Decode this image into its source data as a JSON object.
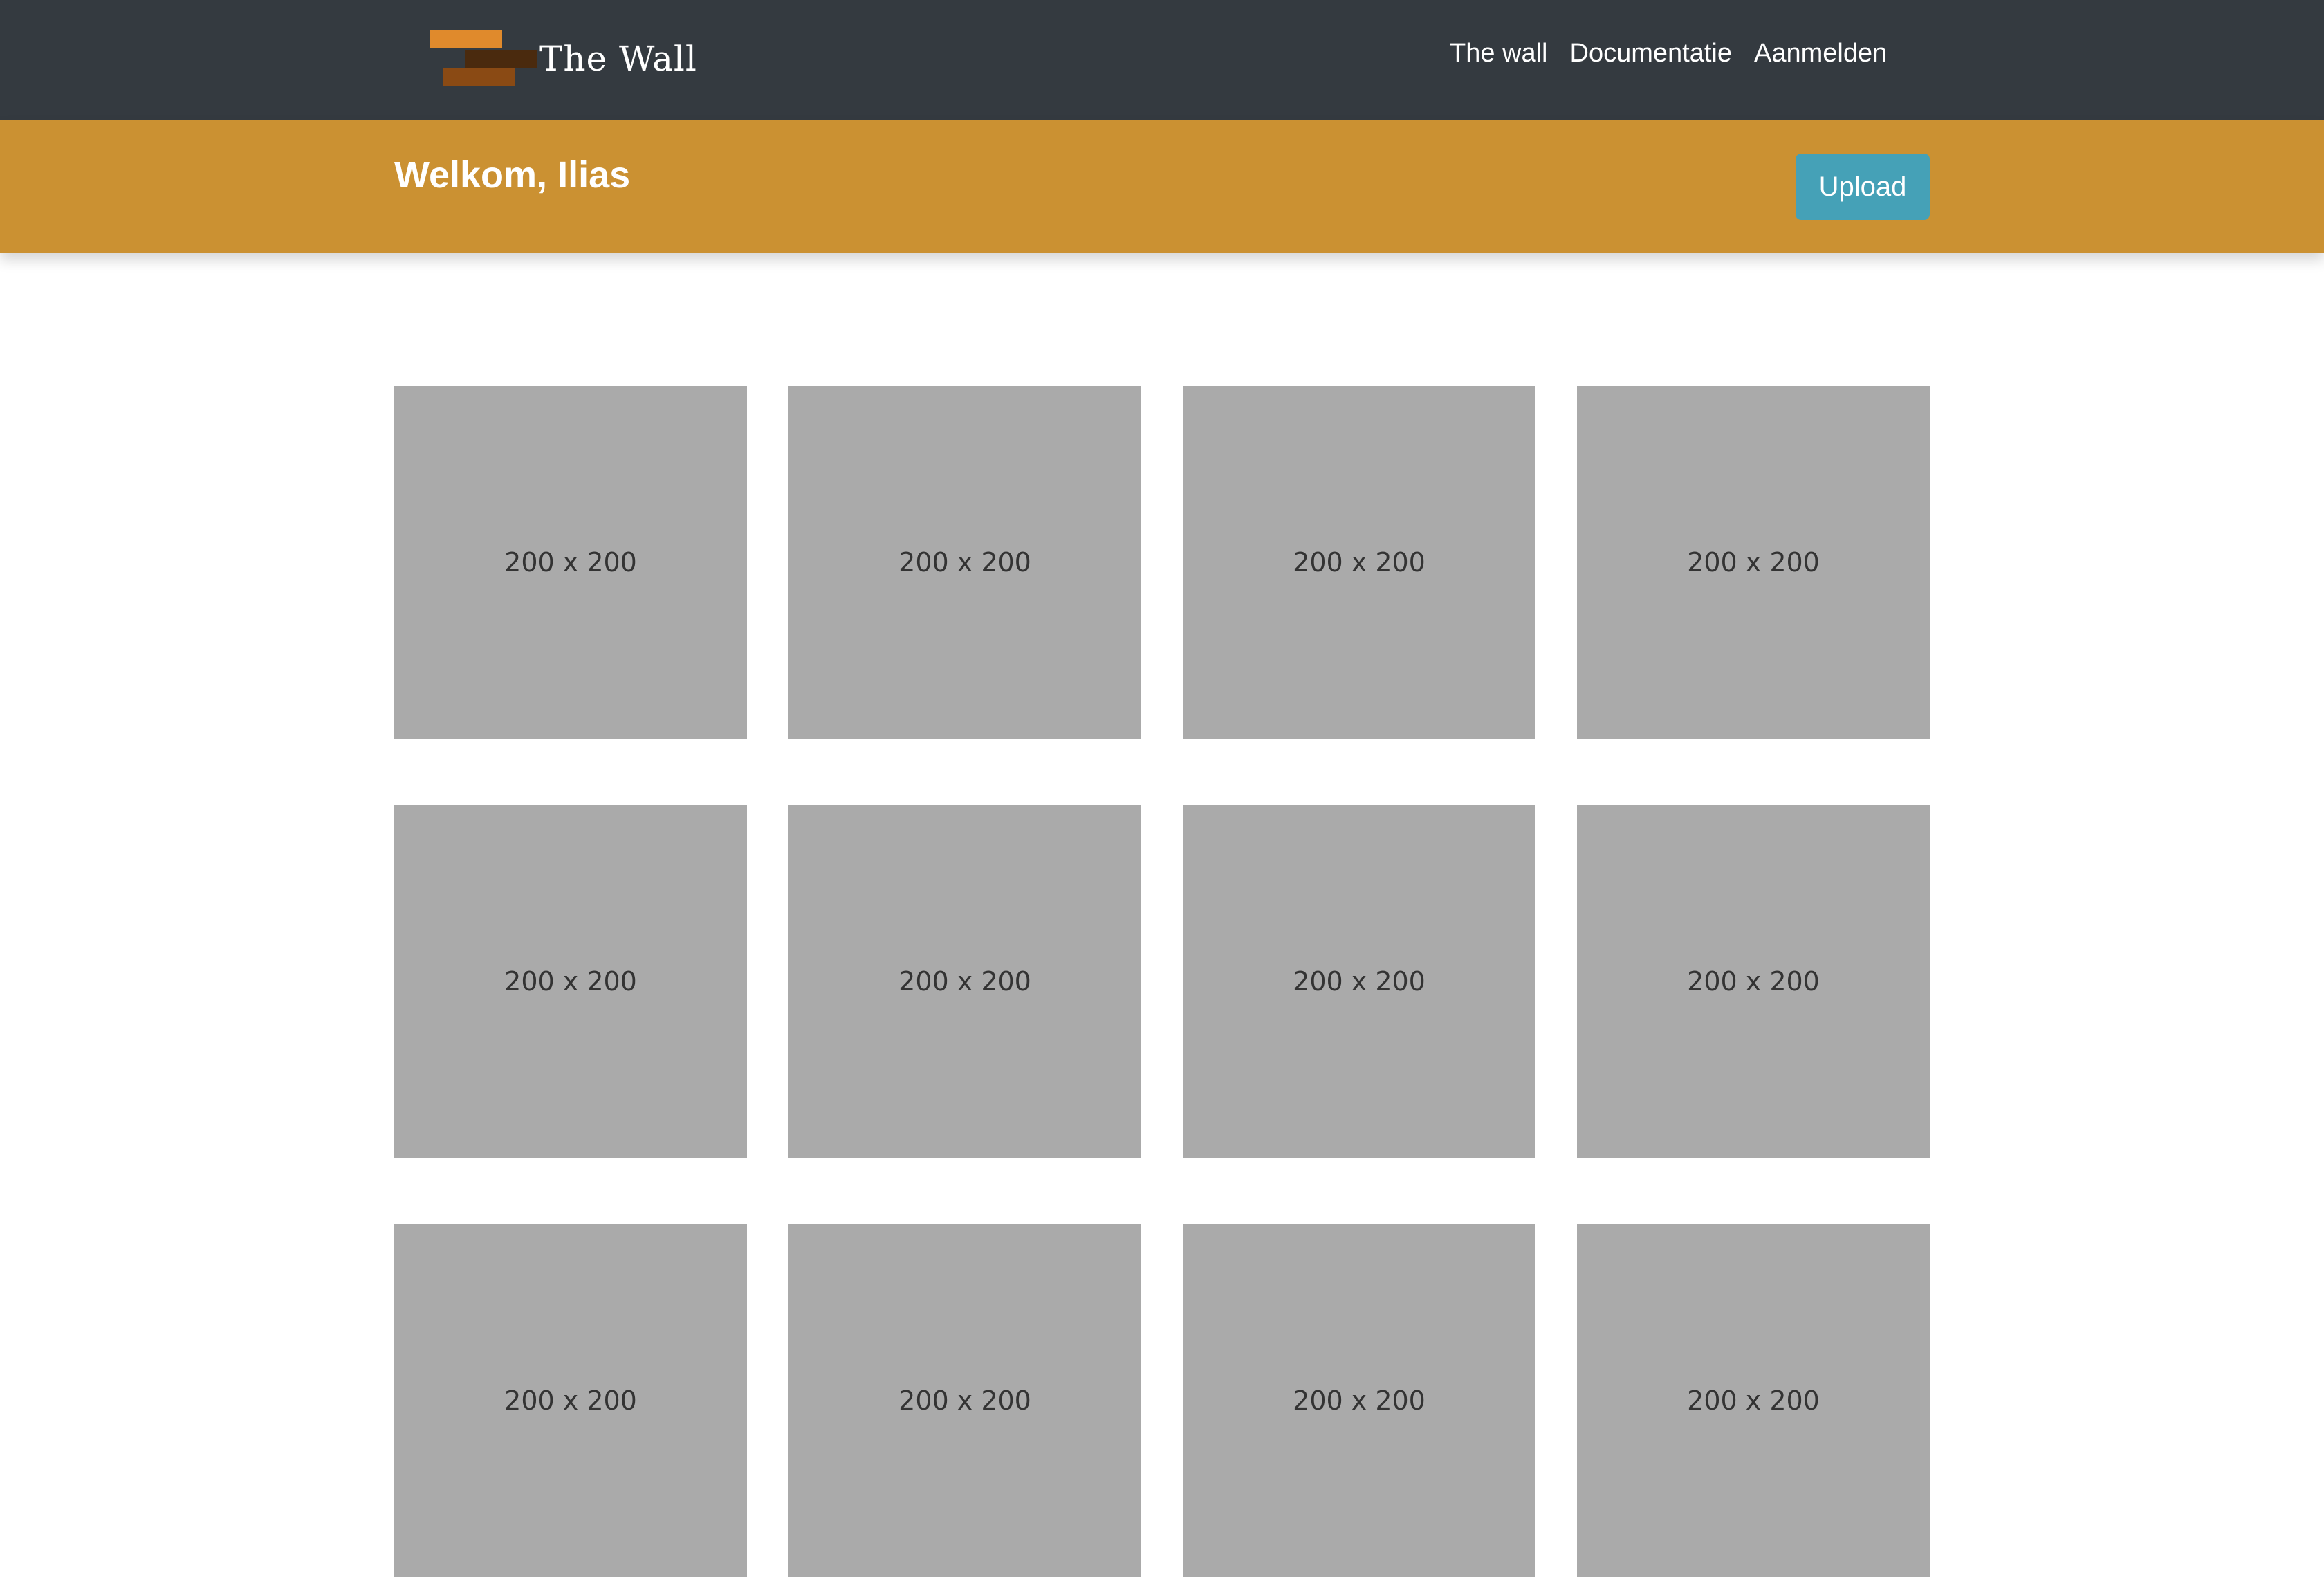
{
  "navbar": {
    "brand_name": "The Wall",
    "logo_colors": [
      "#e08a2c",
      "#4a2a0e",
      "#8a4a14"
    ],
    "links": [
      {
        "label": "The wall"
      },
      {
        "label": "Documentatie"
      },
      {
        "label": "Aanmelden"
      }
    ]
  },
  "banner": {
    "greeting": "Welkom, Ilias",
    "upload_label": "Upload",
    "background_color": "#cb9132",
    "button_color": "#45a1b7"
  },
  "gallery": {
    "placeholder_color": "#aaaaaa",
    "items": [
      {
        "label": "200 x 200"
      },
      {
        "label": "200 x 200"
      },
      {
        "label": "200 x 200"
      },
      {
        "label": "200 x 200"
      },
      {
        "label": "200 x 200"
      },
      {
        "label": "200 x 200"
      },
      {
        "label": "200 x 200"
      },
      {
        "label": "200 x 200"
      },
      {
        "label": "200 x 200"
      },
      {
        "label": "200 x 200"
      },
      {
        "label": "200 x 200"
      },
      {
        "label": "200 x 200"
      }
    ]
  }
}
